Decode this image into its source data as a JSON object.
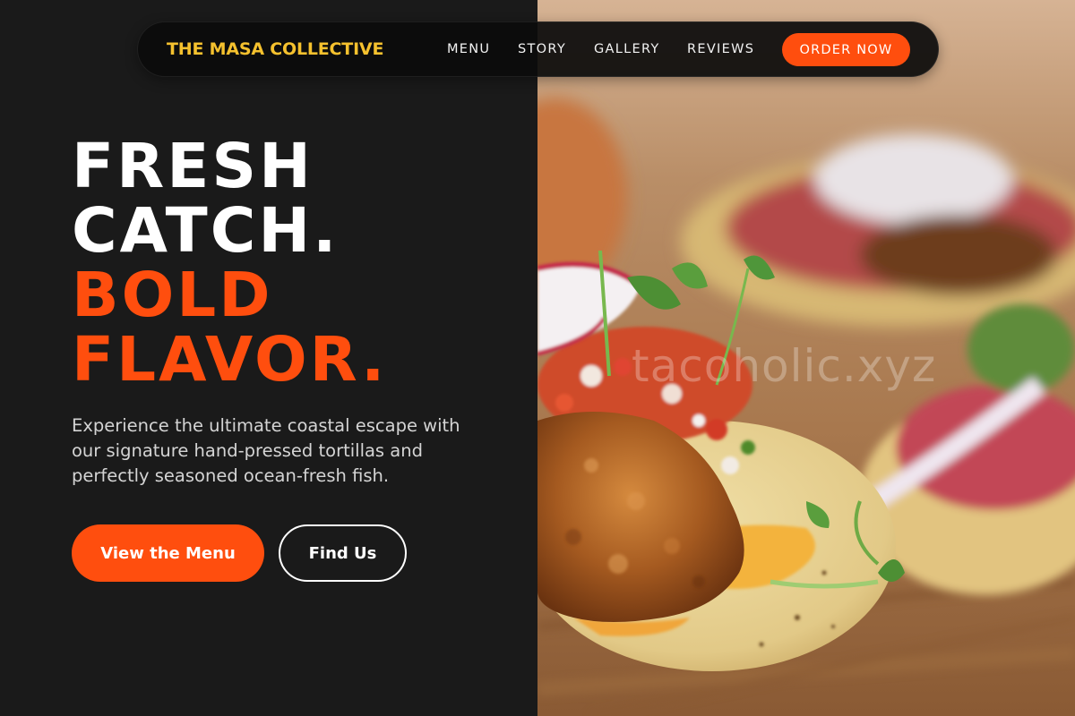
{
  "brand": {
    "name": "THE MASA COLLECTIVE",
    "color": "#f5c12e"
  },
  "nav": {
    "links": [
      "MENU",
      "STORY",
      "GALLERY",
      "REVIEWS"
    ],
    "order_button": "ORDER NOW"
  },
  "hero": {
    "heading_white": [
      "FRESH",
      "CATCH."
    ],
    "heading_accent": [
      "BOLD",
      "FLAVOR."
    ],
    "description": "Experience the ultimate coastal escape with our signature hand-pressed tortillas and perfectly seasoned ocean-fresh fish.",
    "primary_button": "View the Menu",
    "secondary_button": "Find Us"
  },
  "photo": {
    "subject": "fish-tacos-photo",
    "watermark": "tacoholic.xyz"
  },
  "colors": {
    "accent": "#ff4e0e",
    "panel_background": "#1a1a1a",
    "nav_background": "#0c0c0c",
    "text_light": "#d4d4d4"
  }
}
